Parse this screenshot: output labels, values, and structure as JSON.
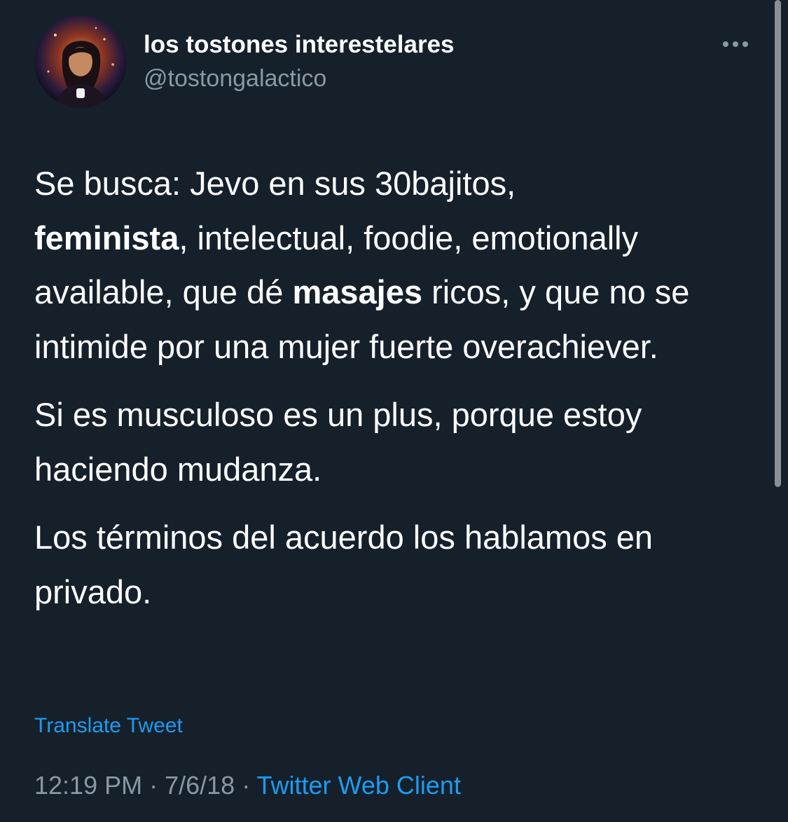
{
  "author": {
    "display_name": "los tostones interestelares",
    "handle": "@tostongalactico",
    "avatar_icon": "profile-photo-avatar"
  },
  "menu": {
    "icon": "more-options-icon"
  },
  "tweet": {
    "p1_a": "Se busca: Jevo en sus 30bajitos,",
    "p1_b": "feminista",
    "p1_c": ", intelectual, foodie, emotionally available, que dé",
    "p1_d": "masajes",
    "p1_e": "ricos, y que no se intimide por una mujer fuerte overachiever.",
    "p2": "Si es musculoso es un plus, porque estoy haciendo mudanza.",
    "p3": "Los términos del acuerdo los hablamos en privado."
  },
  "translate_label": "Translate Tweet",
  "meta": {
    "time": "12:19 PM",
    "separator": " · ",
    "date": "7/6/18",
    "client": "Twitter Web Client"
  },
  "colors": {
    "background": "#15202b",
    "text": "#ffffff",
    "secondary": "#8899a6",
    "link": "#1d9bf0"
  }
}
